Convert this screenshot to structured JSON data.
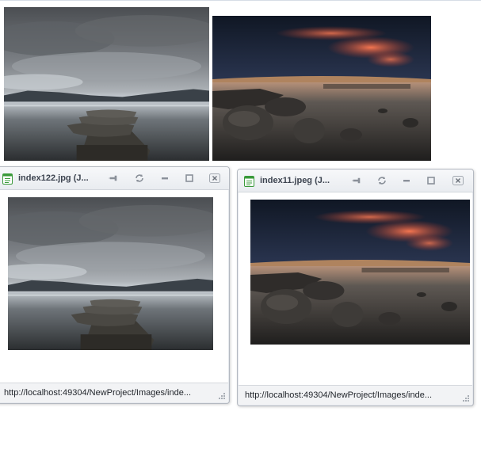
{
  "popups": [
    {
      "title": "index122.jpg (J...",
      "image": "dock-lake-photo",
      "status_url": "http://localhost:49304/NewProject/Images/inde..."
    },
    {
      "title": "index11.jpeg (J...",
      "image": "sunset-rocks-photo",
      "status_url": "http://localhost:49304/NewProject/Images/inde..."
    }
  ],
  "thumbnails": [
    {
      "image": "dock-lake-photo"
    },
    {
      "image": "sunset-rocks-photo"
    }
  ],
  "icons": {
    "app": "document-window-icon",
    "pin": "pin-icon",
    "refresh": "refresh-icon",
    "minimize": "minimize-icon",
    "maximize": "maximize-icon",
    "close": "close-icon"
  },
  "colors": {
    "title_text": "#3d4450",
    "border": "#b4b9c1",
    "app_icon_green": "#3a9a3a"
  }
}
